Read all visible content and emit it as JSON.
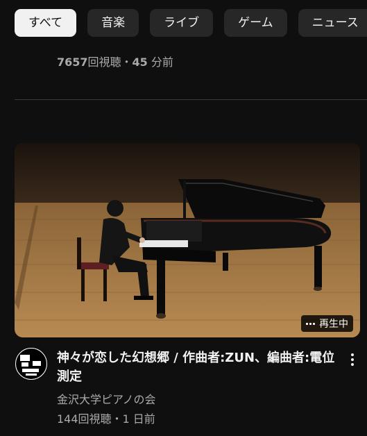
{
  "chips": [
    {
      "label": "すべて",
      "active": true
    },
    {
      "label": "音楽",
      "active": false
    },
    {
      "label": "ライブ",
      "active": false
    },
    {
      "label": "ゲーム",
      "active": false
    },
    {
      "label": "ニュース",
      "active": false
    },
    {
      "label": "",
      "active": false
    }
  ],
  "previous_video": {
    "views": "7657",
    "views_suffix": "回視聴・",
    "age_number": "45",
    "age_suffix": " 分前"
  },
  "video": {
    "title": "神々が恋した幻想郷 / 作曲者:ZUN、編曲者:電位測定",
    "channel": "金沢大学ピアノの会",
    "meta": "144回視聴・1 日前",
    "badge": "再生中",
    "avatar_text": "金沢大学ピアノの会"
  },
  "icons": {
    "more": "more-vert-icon",
    "playing": "equalizer-icon"
  },
  "colors": {
    "background": "#0f0f0f",
    "chip": "#272727",
    "chip_active": "#f1f1f1",
    "secondary_text": "#aaaaaa"
  }
}
